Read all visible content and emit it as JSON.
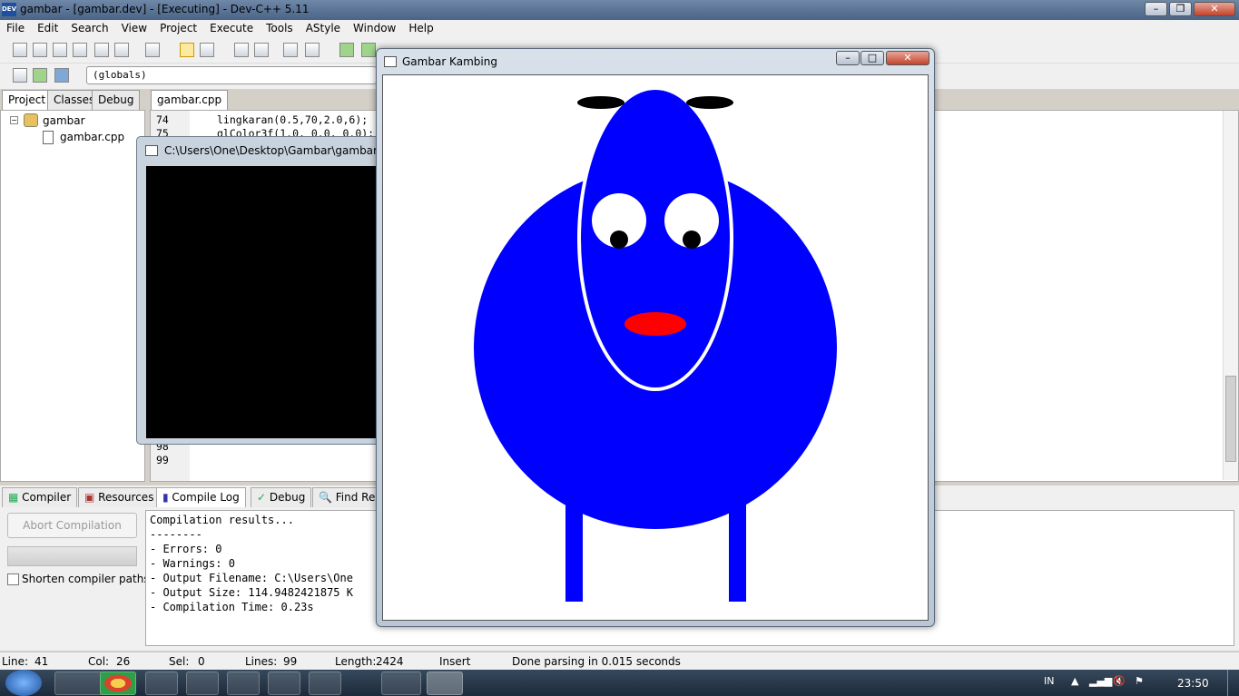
{
  "window": {
    "title": "gambar - [gambar.dev] - [Executing] - Dev-C++ 5.11",
    "icon": "devcpp-icon"
  },
  "menu": [
    "File",
    "Edit",
    "Search",
    "View",
    "Project",
    "Execute",
    "Tools",
    "AStyle",
    "Window",
    "Help"
  ],
  "toolbar": {
    "scope_combo": "(globals)"
  },
  "left_tabs": [
    "Project",
    "Classes",
    "Debug"
  ],
  "project_tree": {
    "root": "gambar",
    "file": "gambar.cpp"
  },
  "editor": {
    "tab": "gambar.cpp",
    "lines": [
      {
        "num": "74",
        "code": "lingkaran(0.5,70,2.0,6);"
      },
      {
        "num": "75",
        "code": "glColor3f(1.0, 0.0, 0.0);"
      },
      {
        "num": "98",
        "code": ""
      },
      {
        "num": "99",
        "code": ""
      }
    ]
  },
  "console": {
    "title": "C:\\Users\\One\\Desktop\\Gambar\\gambar.exe"
  },
  "gl_window": {
    "title": "Gambar Kambing",
    "colors": {
      "body": "#0000ff",
      "eyes": "#ffffff",
      "pupils": "#000000",
      "mouth": "#ff0000",
      "ears": "#000000",
      "face_outline": "#ffffff"
    }
  },
  "bottom_tabs": [
    "Compiler",
    "Resources",
    "Compile Log",
    "Debug",
    "Find Res"
  ],
  "compile": {
    "abort_label": "Abort Compilation",
    "shorten_label": "Shorten compiler paths",
    "log": [
      "Compilation results...",
      "--------",
      "- Errors: 0",
      "- Warnings: 0",
      "- Output Filename: C:\\Users\\One",
      "- Output Size: 114.9482421875 K",
      "- Compilation Time: 0.23s"
    ]
  },
  "status": {
    "line_label": "Line:",
    "line": "41",
    "col_label": "Col:",
    "col": "26",
    "sel_label": "Sel:",
    "sel": "0",
    "lines_label": "Lines:",
    "lines": "99",
    "length_label": "Length:",
    "length": "2424",
    "mode": "Insert",
    "message": "Done parsing in 0.015 seconds"
  },
  "taskbar": {
    "lang": "IN",
    "clock": "23:50"
  }
}
